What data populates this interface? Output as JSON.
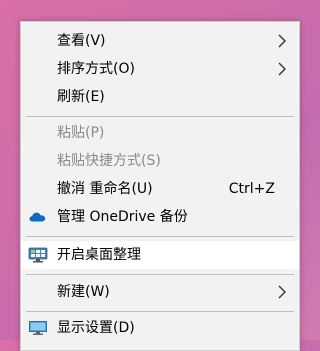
{
  "menu": {
    "items": [
      {
        "label": "查看(V)",
        "submenu": true
      },
      {
        "label": "排序方式(O)",
        "submenu": true
      },
      {
        "label": "刷新(E)"
      },
      {
        "label": "粘贴(P)",
        "disabled": true
      },
      {
        "label": "粘贴快捷方式(S)",
        "disabled": true
      },
      {
        "label": "撤消 重命名(U)",
        "shortcut": "Ctrl+Z"
      },
      {
        "label": "管理 OneDrive 备份",
        "icon": "onedrive-cloud-icon"
      },
      {
        "label": "开启桌面整理",
        "icon": "desktop-organizer-icon",
        "highlighted": true
      },
      {
        "label": "新建(W)",
        "submenu": true
      },
      {
        "label": "显示设置(D)",
        "icon": "display-settings-icon"
      }
    ]
  },
  "colors": {
    "accent_onedrive": "#0f6cbd",
    "menu_background": "#f2f2f2",
    "highlight": "#ffffff",
    "disabled_text": "#8a8a8a"
  }
}
